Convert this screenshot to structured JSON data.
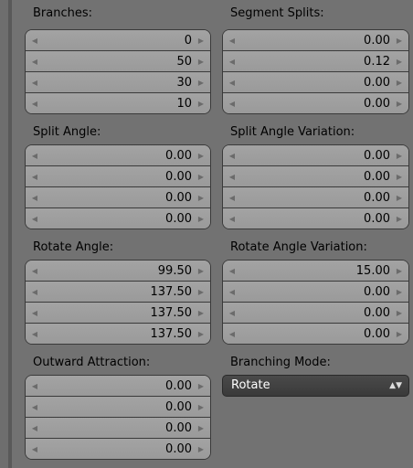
{
  "left": [
    {
      "label": "Branches:",
      "values": [
        "0",
        "50",
        "30",
        "10"
      ]
    },
    {
      "label": "Split Angle:",
      "values": [
        "0.00",
        "0.00",
        "0.00",
        "0.00"
      ]
    },
    {
      "label": "Rotate Angle:",
      "values": [
        "99.50",
        "137.50",
        "137.50",
        "137.50"
      ]
    },
    {
      "label": "Outward Attraction:",
      "values": [
        "0.00",
        "0.00",
        "0.00",
        "0.00"
      ]
    }
  ],
  "right": [
    {
      "label": "Segment Splits:",
      "values": [
        "0.00",
        "0.12",
        "0.00",
        "0.00"
      ]
    },
    {
      "label": "Split Angle Variation:",
      "values": [
        "0.00",
        "0.00",
        "0.00",
        "0.00"
      ]
    },
    {
      "label": "Rotate Angle Variation:",
      "values": [
        "15.00",
        "0.00",
        "0.00",
        "0.00"
      ]
    }
  ],
  "branching_mode": {
    "label": "Branching Mode:",
    "value": "Rotate"
  },
  "icons": {
    "left": "◀",
    "right": "▶",
    "updown": "▲▼"
  }
}
